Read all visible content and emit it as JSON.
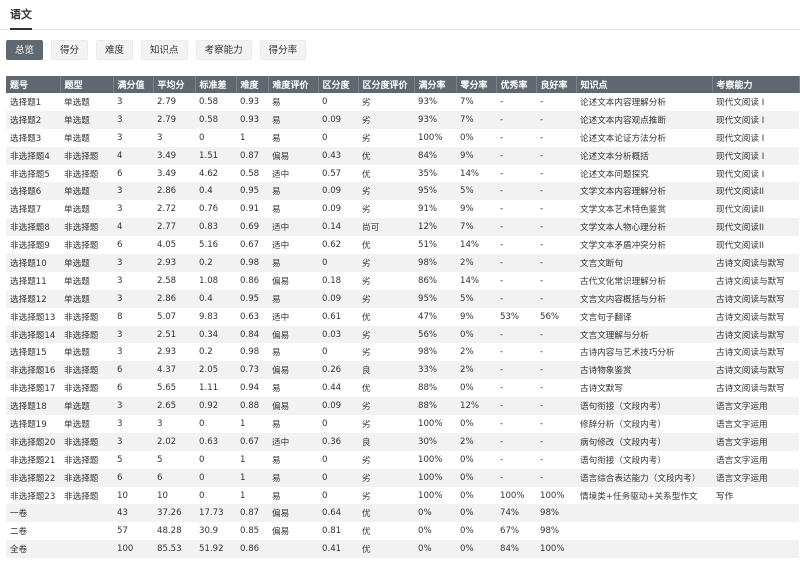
{
  "header": {
    "tab": "语文"
  },
  "subtabs": [
    "总览",
    "得分",
    "难度",
    "知识点",
    "考察能力",
    "得分率"
  ],
  "active_subtab": 0,
  "columns": [
    "题号",
    "题型",
    "满分值",
    "平均分",
    "标准差",
    "难度",
    "难度评价",
    "区分度",
    "区分度评价",
    "满分率",
    "零分率",
    "优秀率",
    "良好率",
    "知识点",
    "考察能力"
  ],
  "rows": [
    [
      "选择题1",
      "单选题",
      "3",
      "2.79",
      "0.58",
      "0.93",
      "易",
      "0",
      "劣",
      "93%",
      "7%",
      "-",
      "-",
      "论述文本内容理解分析",
      "现代文阅读 I"
    ],
    [
      "选择题2",
      "单选题",
      "3",
      "2.79",
      "0.58",
      "0.93",
      "易",
      "0.09",
      "劣",
      "93%",
      "7%",
      "-",
      "-",
      "论述文本内容观点推断",
      "现代文阅读 I"
    ],
    [
      "选择题3",
      "单选题",
      "3",
      "3",
      "0",
      "1",
      "易",
      "0",
      "劣",
      "100%",
      "0%",
      "-",
      "-",
      "论述文本论证方法分析",
      "现代文阅读 I"
    ],
    [
      "非选择题4",
      "非选择题",
      "4",
      "3.49",
      "1.51",
      "0.87",
      "偏易",
      "0.43",
      "优",
      "84%",
      "9%",
      "-",
      "-",
      "论述文本分析概括",
      "现代文阅读 I"
    ],
    [
      "非选择题5",
      "非选择题",
      "6",
      "3.49",
      "4.62",
      "0.58",
      "适中",
      "0.57",
      "优",
      "35%",
      "14%",
      "-",
      "-",
      "论述文本问题探究",
      "现代文阅读 I"
    ],
    [
      "选择题6",
      "单选题",
      "3",
      "2.86",
      "0.4",
      "0.95",
      "易",
      "0.09",
      "劣",
      "95%",
      "5%",
      "-",
      "-",
      "文学文本内容理解分析",
      "现代文阅读II"
    ],
    [
      "选择题7",
      "单选题",
      "3",
      "2.72",
      "0.76",
      "0.91",
      "易",
      "0.09",
      "劣",
      "91%",
      "9%",
      "-",
      "-",
      "文学文本艺术特色鉴赏",
      "现代文阅读II"
    ],
    [
      "非选择题8",
      "非选择题",
      "4",
      "2.77",
      "0.83",
      "0.69",
      "适中",
      "0.14",
      "尚可",
      "12%",
      "7%",
      "-",
      "-",
      "文学文本人物心理分析",
      "现代文阅读II"
    ],
    [
      "非选择题9",
      "非选择题",
      "6",
      "4.05",
      "5.16",
      "0.67",
      "适中",
      "0.62",
      "优",
      "51%",
      "14%",
      "-",
      "-",
      "文学文本矛盾冲突分析",
      "现代文阅读II"
    ],
    [
      "选择题10",
      "单选题",
      "3",
      "2.93",
      "0.2",
      "0.98",
      "易",
      "0",
      "劣",
      "98%",
      "2%",
      "-",
      "-",
      "文言文断句",
      "古诗文阅读与默写"
    ],
    [
      "选择题11",
      "单选题",
      "3",
      "2.58",
      "1.08",
      "0.86",
      "偏易",
      "0.18",
      "劣",
      "86%",
      "14%",
      "-",
      "-",
      "古代文化常识理解分析",
      "古诗文阅读与默写"
    ],
    [
      "选择题12",
      "单选题",
      "3",
      "2.86",
      "0.4",
      "0.95",
      "易",
      "0.09",
      "劣",
      "95%",
      "5%",
      "-",
      "-",
      "文言文内容概括与分析",
      "古诗文阅读与默写"
    ],
    [
      "非选择题13",
      "非选择题",
      "8",
      "5.07",
      "9.83",
      "0.63",
      "适中",
      "0.61",
      "优",
      "47%",
      "9%",
      "53%",
      "56%",
      "文言句子翻译",
      "古诗文阅读与默写"
    ],
    [
      "非选择题14",
      "非选择题",
      "3",
      "2.51",
      "0.34",
      "0.84",
      "偏易",
      "0.03",
      "劣",
      "56%",
      "0%",
      "-",
      "-",
      "文言文理解与分析",
      "古诗文阅读与默写"
    ],
    [
      "选择题15",
      "单选题",
      "3",
      "2.93",
      "0.2",
      "0.98",
      "易",
      "0",
      "劣",
      "98%",
      "2%",
      "-",
      "-",
      "古诗内容与艺术技巧分析",
      "古诗文阅读与默写"
    ],
    [
      "非选择题16",
      "非选择题",
      "6",
      "4.37",
      "2.05",
      "0.73",
      "偏易",
      "0.26",
      "良",
      "33%",
      "2%",
      "-",
      "-",
      "古诗物象鉴赏",
      "古诗文阅读与默写"
    ],
    [
      "非选择题17",
      "非选择题",
      "6",
      "5.65",
      "1.11",
      "0.94",
      "易",
      "0.44",
      "优",
      "88%",
      "0%",
      "-",
      "-",
      "古诗文默写",
      "古诗文阅读与默写"
    ],
    [
      "选择题18",
      "单选题",
      "3",
      "2.65",
      "0.92",
      "0.88",
      "偏易",
      "0.09",
      "劣",
      "88%",
      "12%",
      "-",
      "-",
      "语句衔接（文段内考）",
      "语言文字运用"
    ],
    [
      "选择题19",
      "单选题",
      "3",
      "3",
      "0",
      "1",
      "易",
      "0",
      "劣",
      "100%",
      "0%",
      "-",
      "-",
      "修辞分析（文段内考）",
      "语言文字运用"
    ],
    [
      "非选择题20",
      "非选择题",
      "3",
      "2.02",
      "0.63",
      "0.67",
      "适中",
      "0.36",
      "良",
      "30%",
      "2%",
      "-",
      "-",
      "病句修改（文段内考）",
      "语言文字运用"
    ],
    [
      "非选择题21",
      "非选择题",
      "5",
      "5",
      "0",
      "1",
      "易",
      "0",
      "劣",
      "100%",
      "0%",
      "-",
      "-",
      "语句衔接（文段内考）",
      "语言文字运用"
    ],
    [
      "非选择题22",
      "非选择题",
      "6",
      "6",
      "0",
      "1",
      "易",
      "0",
      "劣",
      "100%",
      "0%",
      "-",
      "-",
      "语言综合表达能力（文段内考）",
      "语言文字运用"
    ],
    [
      "非选择题23",
      "非选择题",
      "10",
      "10",
      "0",
      "1",
      "易",
      "0",
      "劣",
      "100%",
      "0%",
      "100%",
      "100%",
      "情境类+任务驱动+关系型作文",
      "写作"
    ],
    [
      "一卷",
      "",
      "43",
      "37.26",
      "17.73",
      "0.87",
      "偏易",
      "0.64",
      "优",
      "0%",
      "0%",
      "74%",
      "98%",
      "",
      ""
    ],
    [
      "二卷",
      "",
      "57",
      "48.28",
      "30.9",
      "0.85",
      "偏易",
      "0.81",
      "优",
      "0%",
      "0%",
      "67%",
      "98%",
      "",
      ""
    ],
    [
      "全卷",
      "",
      "100",
      "85.53",
      "51.92",
      "0.86",
      "",
      "0.41",
      "优",
      "0%",
      "0%",
      "84%",
      "100%",
      "",
      ""
    ]
  ]
}
